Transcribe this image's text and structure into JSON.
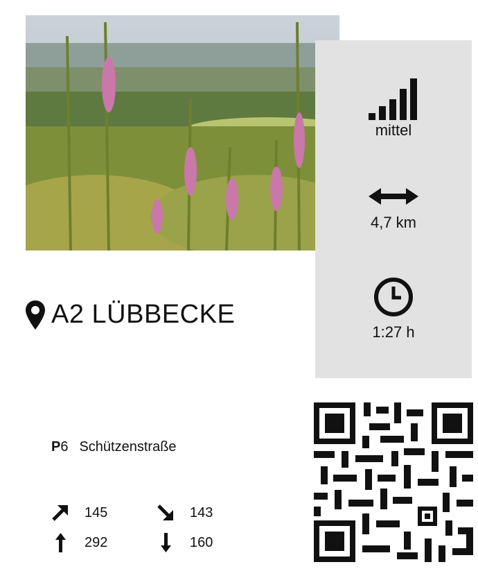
{
  "header": {
    "title": "A2 LÜBBECKE",
    "title_icon": "location-pin-icon"
  },
  "stats": {
    "difficulty": {
      "icon": "signal-bars-icon",
      "label": "mittel"
    },
    "distance": {
      "icon": "horizontal-arrow-icon",
      "label": "4,7 km"
    },
    "duration": {
      "icon": "clock-icon",
      "label": "1:27 h"
    }
  },
  "parking": {
    "prefix": "P",
    "number": "6",
    "street": "Schützenstraße"
  },
  "elevation": {
    "ascent_diag": "145",
    "descent_diag": "143",
    "max_up": "292",
    "min_down": "160"
  },
  "image": {
    "icon": "landscape-photo"
  },
  "qr": {
    "icon": "qr-code"
  },
  "colors": {
    "panel_bg": "#e2e2e2",
    "text": "#111111"
  }
}
